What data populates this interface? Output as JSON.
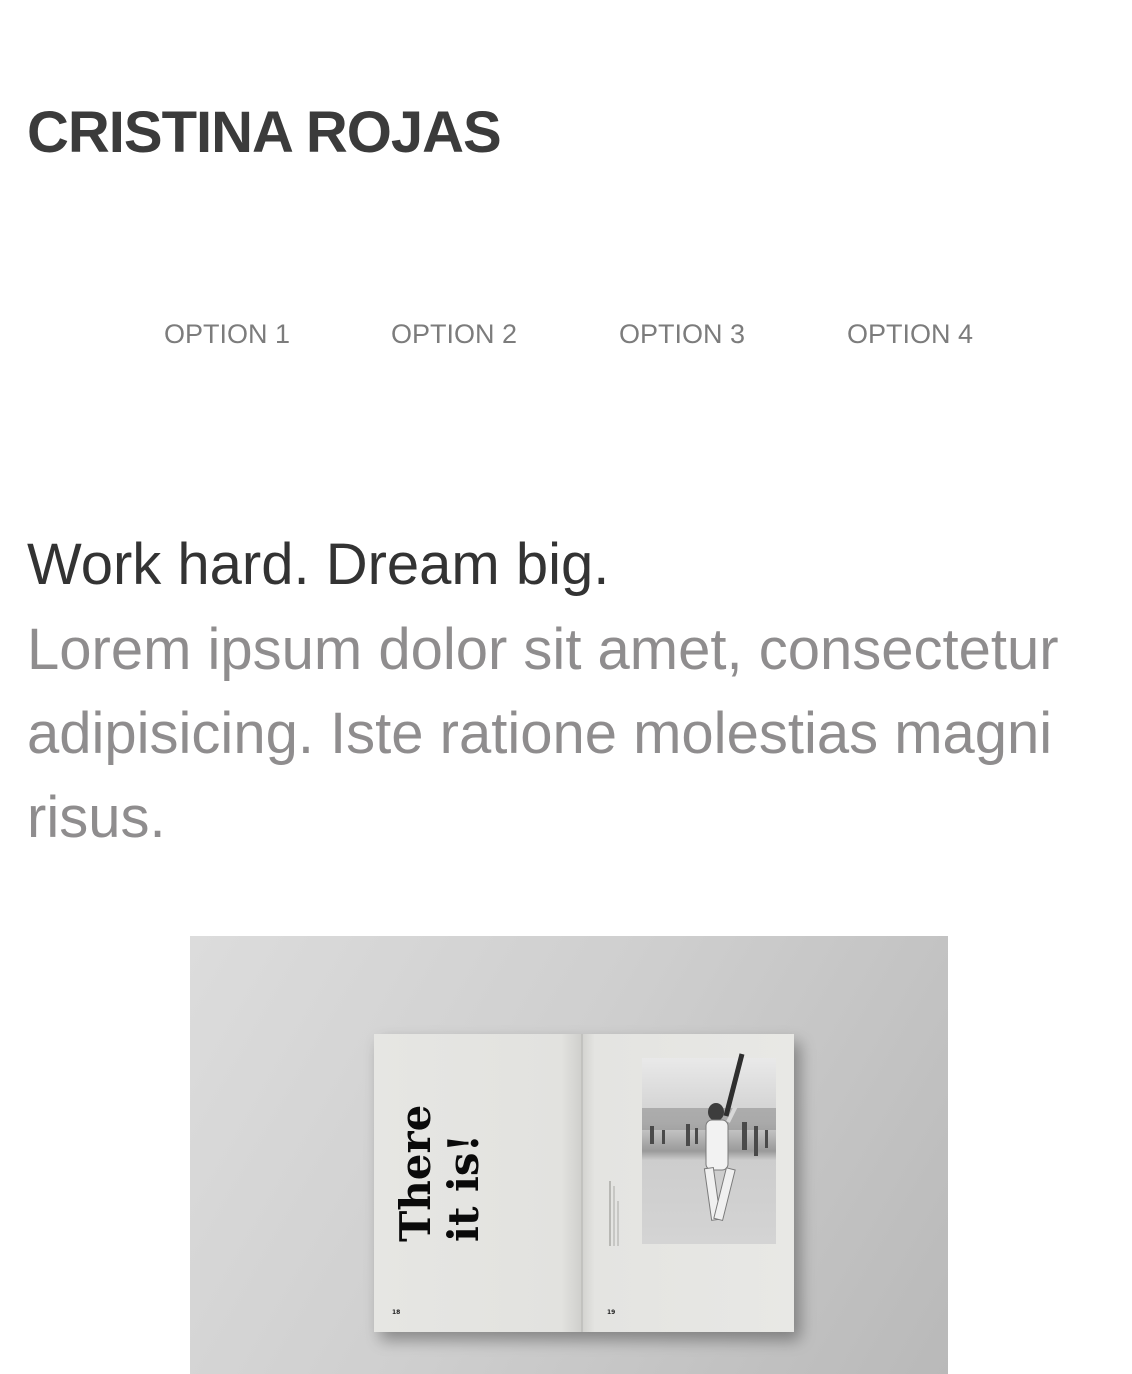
{
  "header": {
    "site_title": "CRISTINA ROJAS"
  },
  "nav": {
    "items": [
      {
        "label": "OPTION 1"
      },
      {
        "label": "OPTION 2"
      },
      {
        "label": "OPTION 3"
      },
      {
        "label": "OPTION 4"
      }
    ]
  },
  "hero": {
    "heading": "Work hard. Dream big.",
    "body": "Lorem ipsum dolor sit amet, consectetur adipisicing. Iste ratione molestias magni risus."
  },
  "image": {
    "headline_line1": "There",
    "headline_line2": "it is!",
    "left_page_number": "18",
    "right_page_number": "19"
  },
  "colors": {
    "title": "#3b3b3b",
    "nav": "#7c7c7c",
    "heading": "#333333",
    "body": "#8f8d8e"
  }
}
